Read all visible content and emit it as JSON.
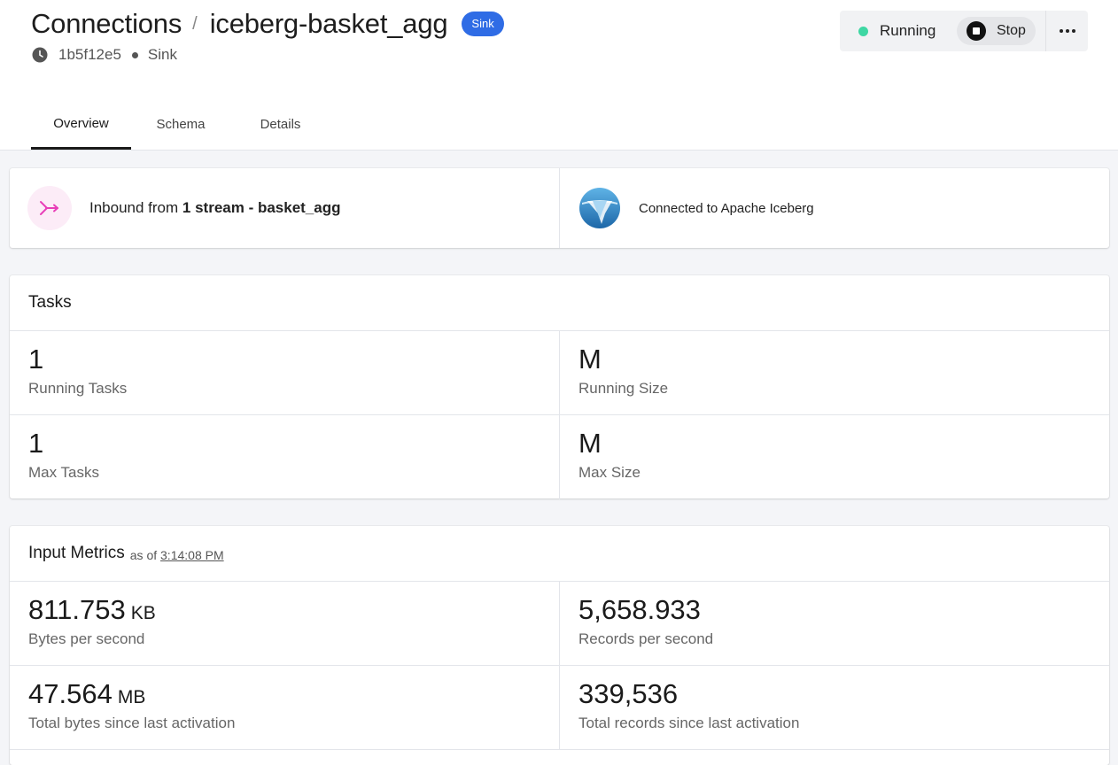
{
  "breadcrumb": {
    "parent": "Connections",
    "separator": "/",
    "current": "iceberg-basket_agg",
    "badge": "Sink"
  },
  "meta": {
    "id": "1b5f12e5",
    "type": "Sink",
    "icon": "clock-icon"
  },
  "status": {
    "label": "Running",
    "color": "#3ed7a3",
    "stop_label": "Stop"
  },
  "tabs": [
    {
      "label": "Overview",
      "active": true
    },
    {
      "label": "Schema",
      "active": false
    },
    {
      "label": "Details",
      "active": false
    }
  ],
  "connection": {
    "inbound_prefix": "Inbound from ",
    "inbound_bold": "1 stream - basket_agg",
    "target_text": "Connected to Apache Iceberg"
  },
  "tasks": {
    "title": "Tasks",
    "items": [
      {
        "value": "1",
        "label": "Running Tasks"
      },
      {
        "value": "M",
        "label": "Running Size"
      },
      {
        "value": "1",
        "label": "Max Tasks"
      },
      {
        "value": "M",
        "label": "Max Size"
      }
    ]
  },
  "metrics": {
    "title": "Input Metrics",
    "as_of_prefix": "as of",
    "as_of_time": "3:14:08 PM",
    "items": [
      {
        "value": "811.753",
        "unit": "KB",
        "label": "Bytes per second"
      },
      {
        "value": "5,658.933",
        "unit": "",
        "label": "Records per second"
      },
      {
        "value": "47.564",
        "unit": "MB",
        "label": "Total bytes since last activation"
      },
      {
        "value": "339,536",
        "unit": "",
        "label": "Total records since last activation"
      }
    ]
  },
  "colors": {
    "badge": "#2f6ce5",
    "accent_pink": "#e83fb8",
    "iceberg_blue": "#2a7ec4"
  }
}
